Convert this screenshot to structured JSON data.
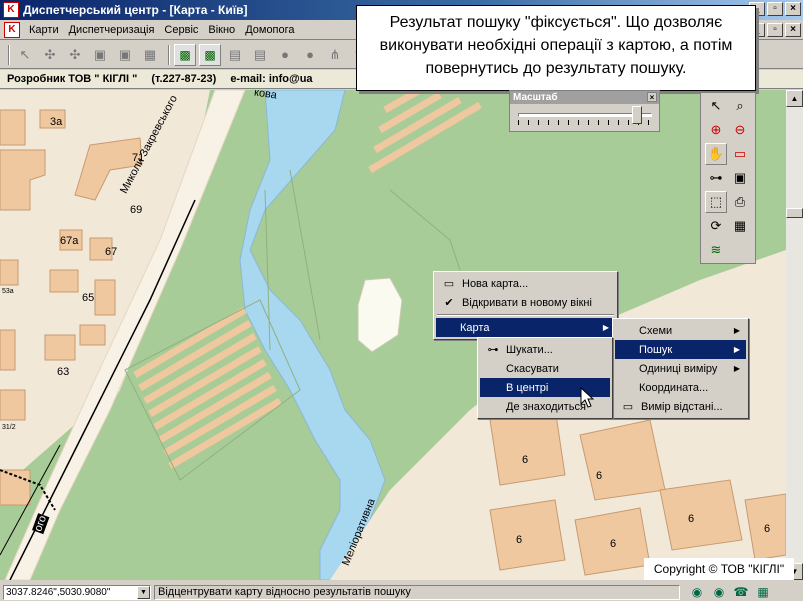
{
  "window": {
    "title": "Диспетчерський центр - [Карта - Київ]",
    "app_icon": "app-logo-icon",
    "buttons": [
      "minimize-icon",
      "maximize-icon",
      "close-icon"
    ]
  },
  "menubar": {
    "items": [
      "Карти",
      "Диспетчеризація",
      "Сервіс",
      "Вікно",
      "Домопога"
    ]
  },
  "devbar": {
    "developer": "Розробник ТОВ \" КІГЛІ \"",
    "phone": "(т.227-87-23)",
    "email": "e-mail: info@ua"
  },
  "tooltip": {
    "text": "Результат пошуку \"фіксується\". Що дозволяє виконувати необхідні операції з картою, а потім повернутись до результату пошуку."
  },
  "scale_panel": {
    "title": "Масштаб",
    "level": 0.92
  },
  "map_labels": {
    "street_zakrevskogo": "Миколи Закревського",
    "street_meliorativna": "Меліоративна",
    "street_top": "кова",
    "buildings": [
      "3а",
      "71",
      "69",
      "67а",
      "67",
      "65",
      "63",
      "6",
      "6",
      "6",
      "6",
      "6",
      "6"
    ],
    "side_small": [
      "53а",
      "31/2"
    ],
    "edge_text": "ого"
  },
  "context_menu": {
    "items": [
      {
        "label": "Нова карта...",
        "icon": "new-map-icon"
      },
      {
        "label": "Відкривати в новому вікні",
        "icon": "checkmark-icon"
      },
      {
        "label": "Карта",
        "submenu": true
      }
    ]
  },
  "karta_submenu": {
    "items": [
      {
        "label": "Схеми",
        "submenu": true
      },
      {
        "label": "Пошук",
        "submenu": true
      },
      {
        "label": "Одиниці виміру",
        "submenu": true
      },
      {
        "label": "Координата...",
        "submenu": false
      },
      {
        "label": "Вимір відстані...",
        "icon": "ruler-icon"
      }
    ]
  },
  "search_submenu": {
    "items": [
      {
        "label": "Шукати...",
        "icon": "binoculars-icon"
      },
      {
        "label": "Скасувати"
      },
      {
        "label": "В центрі"
      },
      {
        "label": "Де знаходиться"
      }
    ]
  },
  "copyright": "Copyright  ©  ТОВ \"КІГЛІ\"",
  "statusbar": {
    "coords": "3037.8246\",5030.9080\"",
    "message": "Відцентрувати карту відносно результатів пошуку"
  },
  "colors": {
    "map_bg": "#f2e8d8",
    "green": "#a8cc98",
    "water": "#a8d8f0",
    "building": "#f0c8a0",
    "highlight": "#0a246a"
  }
}
